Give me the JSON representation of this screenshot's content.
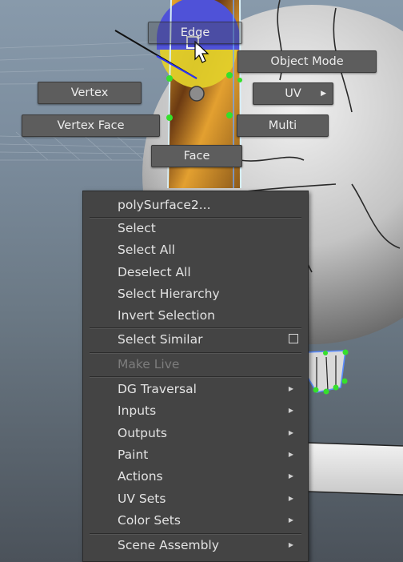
{
  "marking_menu": {
    "edge": "Edge",
    "object_mode": "Object Mode",
    "vertex": "Vertex",
    "uv": "UV",
    "vertex_face": "Vertex Face",
    "multi": "Multi",
    "face": "Face"
  },
  "context_menu": {
    "title": "polySurface2...",
    "items": {
      "select": "Select",
      "select_all": "Select All",
      "deselect_all": "Deselect All",
      "select_hierarchy": "Select Hierarchy",
      "invert_selection": "Invert Selection",
      "select_similar": "Select Similar",
      "make_live": "Make Live",
      "dg_traversal": "DG Traversal",
      "inputs": "Inputs",
      "outputs": "Outputs",
      "paint": "Paint",
      "actions": "Actions",
      "uv_sets": "UV Sets",
      "color_sets": "Color Sets",
      "scene_assembly": "Scene Assembly"
    }
  },
  "icons": {
    "submenu": "submenu-arrow-icon",
    "option_box": "option-box-icon",
    "cursor": "mouse-pointer-icon"
  },
  "colors": {
    "viewport_bg": "#7c8d9e",
    "menu_bg": "#444444",
    "button_bg": "#5d5d5d",
    "highlight_blue": "#4f52d8",
    "highlight_yellow": "#e2cf2a",
    "vertex_green": "#35e02b"
  }
}
